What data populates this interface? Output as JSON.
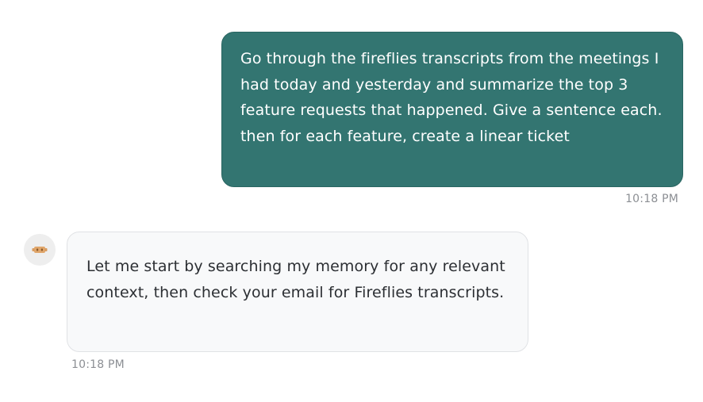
{
  "conversation": {
    "user_message": {
      "text": "Go through the fireflies transcripts from the meetings I had today and yesterday and summarize the top 3 feature requests that happened. Give a sentence each. then for each feature, create a linear ticket",
      "timestamp": "10:18 PM"
    },
    "assistant_message": {
      "avatar_icon": "bot-logo-icon",
      "text": "Let me start by searching my memory for any relevant context, then check your email for Fireflies transcripts.",
      "timestamp": "10:18 PM"
    }
  },
  "colors": {
    "user_bubble": "#337571",
    "assistant_bubble": "#f8f9fa",
    "timestamp": "#8c8f94",
    "avatar_accent": "#d99b5e"
  }
}
